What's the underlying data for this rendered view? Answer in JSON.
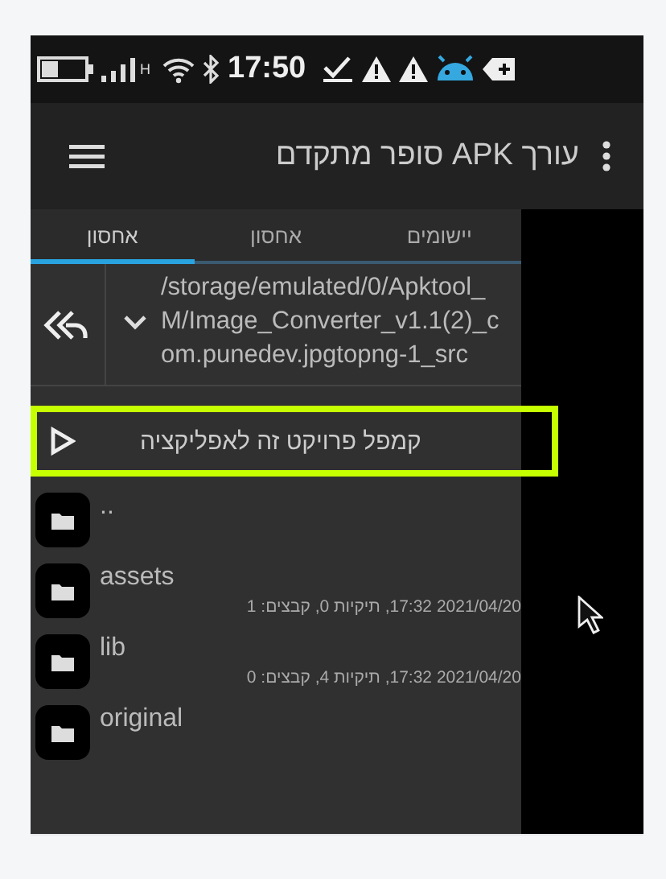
{
  "status_bar": {
    "network": "H",
    "time": "17:50"
  },
  "app_bar": {
    "title": "עורך APK סופר מתקדם"
  },
  "tabs": [
    {
      "label": "יישומים",
      "selected": false
    },
    {
      "label": "אחסון",
      "selected": false
    },
    {
      "label": "אחסון",
      "selected": true
    }
  ],
  "path": "/storage/emulated/0/Apktool_M/Image_Converter_v1.1(2)_com.punedev.jpgtopng-1_src",
  "action": {
    "label": "קמפל פרויקט זה לאפליקציה",
    "highlighted": true
  },
  "files": [
    {
      "name": ".."
    },
    {
      "name": "assets",
      "meta": "2021/04/20 17:32, תיקיות 0, קבצים: 1"
    },
    {
      "name": "lib",
      "meta": "2021/04/20 17:32, תיקיות 4, קבצים: 0"
    },
    {
      "name": "original"
    }
  ]
}
